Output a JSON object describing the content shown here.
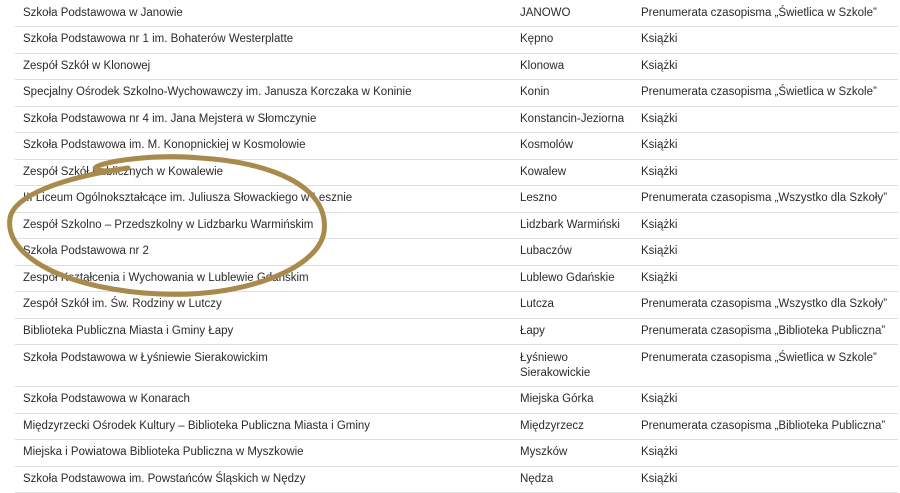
{
  "rows": [
    {
      "school": "Szkoła Podstawowa w Janowie",
      "place": "JANOWO",
      "award": "Prenumerata czasopisma „Świetlica w Szkole”"
    },
    {
      "school": "Szkoła Podstawowa nr 1 im. Bohaterów Westerplatte",
      "place": "Kępno",
      "award": "Książki"
    },
    {
      "school": "Zespół Szkół w Klonowej",
      "place": "Klonowa",
      "award": "Książki"
    },
    {
      "school": "Specjalny Ośrodek Szkolno-Wychowawczy im. Janusza Korczaka w Koninie",
      "place": "Konin",
      "award": "Prenumerata czasopisma „Świetlica w Szkole”"
    },
    {
      "school": "Szkoła Podstawowa nr 4 im. Jana Mejstera w Słomczynie",
      "place": "Konstancin-Jeziorna",
      "award": "Książki"
    },
    {
      "school": "Szkoła Podstawowa im. M. Konopnickiej w Kosmolowie",
      "place": "Kosmolów",
      "award": "Książki"
    },
    {
      "school": "Zespół Szkół Publicznych w Kowalewie",
      "place": "Kowalew",
      "award": "Książki"
    },
    {
      "school": "III Liceum Ogólnokształcące im. Juliusza Słowackiego w Lesznie",
      "place": "Leszno",
      "award": "Prenumerata czasopisma „Wszystko dla Szkoły”"
    },
    {
      "school": "Zespół Szkolno – Przedszkolny w Lidzbarku Warmińskim",
      "place": "Lidzbark Warmiński",
      "award": "Książki"
    },
    {
      "school": "Szkoła Podstawowa nr 2",
      "place": "Lubaczów",
      "award": "Książki"
    },
    {
      "school": "Zespół Kształcenia i Wychowania w Lublewie Gdańskim",
      "place": "Lublewo Gdańskie",
      "award": "Książki"
    },
    {
      "school": "Zespół Szkół im. Św. Rodziny w Lutczy",
      "place": "Lutcza",
      "award": "Prenumerata czasopisma „Wszystko dla Szkoły”"
    },
    {
      "school": "Biblioteka Publiczna Miasta i Gminy Łapy",
      "place": "Łapy",
      "award": "Prenumerata czasopisma „Biblioteka Publiczna”"
    },
    {
      "school": "Szkoła Podstawowa w Łyśniewie Sierakowickim",
      "place": "Łyśniewo Sierakowickie",
      "award": "Prenumerata czasopisma „Świetlica w Szkole”"
    },
    {
      "school": "Szkoła Podstawowa w Konarach",
      "place": "Miejska Górka",
      "award": "Książki"
    },
    {
      "school": "Międzyrzecki Ośrodek Kultury – Biblioteka Publiczna Miasta i Gminy",
      "place": "Międzyrzecz",
      "award": "Prenumerata czasopisma „Biblioteka Publiczna”"
    },
    {
      "school": "Miejska i Powiatowa Biblioteka Publiczna w Myszkowie",
      "place": "Myszków",
      "award": "Książki"
    },
    {
      "school": "Szkoła Podstawowa im. Powstańców Śląskich w Nędzy",
      "place": "Nędza",
      "award": "Książki"
    }
  ],
  "annotation": {
    "color": "#a88a4c"
  }
}
